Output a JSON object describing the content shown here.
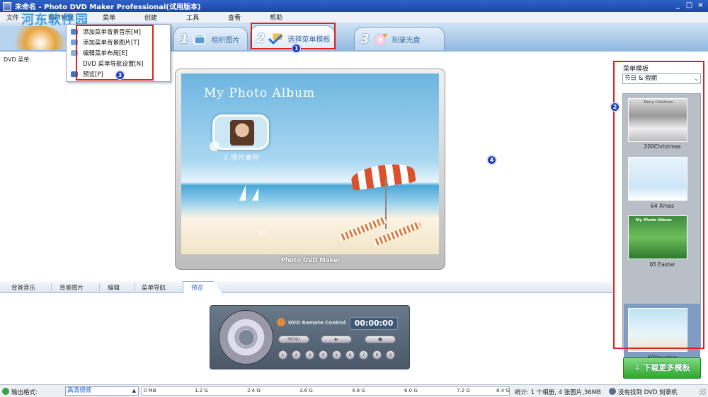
{
  "window": {
    "title": "未命名 - Photo DVD Maker Professional(试用版本)",
    "controls": [
      "_",
      "□",
      "×"
    ]
  },
  "menubar": {
    "items": [
      "文件",
      "照片管理",
      "菜单",
      "创建",
      "工具",
      "查看",
      "帮助"
    ]
  },
  "menu_dropdown": {
    "items": [
      {
        "label": "添加菜单背景音乐[M]"
      },
      {
        "label": "添加菜单背景图片[T]"
      },
      {
        "label": "编辑菜单布局[E]"
      },
      {
        "label": "DVD 菜单导航设置[N]"
      },
      {
        "label": "预览[P]"
      }
    ]
  },
  "steps": [
    {
      "num": "1",
      "label": "组织图片"
    },
    {
      "num": "2",
      "label": "选择菜单模板"
    },
    {
      "num": "3",
      "label": "刻录光盘"
    }
  ],
  "watermark": "河东软件园",
  "dvd_menu_label": "DVD 菜单:",
  "badges": [
    "1",
    "2",
    "3",
    "4"
  ],
  "preview": {
    "album_title": "My Photo Album",
    "photo_caption": "1.图片素材",
    "page_counter": "1/1",
    "frame_caption": "Photo DVD Maker"
  },
  "bottom_tabs": [
    "背景音乐",
    "背景图片",
    "编辑",
    "菜单导航",
    "预览"
  ],
  "remote": {
    "label": "DVD Remote Control",
    "time": "00:00:00",
    "menu_label": "MENU",
    "play_label": "▶",
    "stop_label": "■",
    "numbers": [
      "1",
      "2",
      "3",
      "4",
      "5",
      "6",
      "7",
      "8",
      "9"
    ]
  },
  "template_panel": {
    "title": "菜单模板",
    "category": "节日 & 假期",
    "templates": [
      {
        "name": "200Christmas"
      },
      {
        "name": "64 Xmas"
      },
      {
        "name": "65 Easter"
      },
      {
        "name": "69Vacation"
      }
    ],
    "selected_index": 3,
    "thumb_text": {
      "christmas": "Merry Christmas",
      "easter": "My Photo Album"
    }
  },
  "download_button": "下载更多模板",
  "statusbar": {
    "format_label": "输出格式:",
    "format_value": "高清视频",
    "capacity_ticks": [
      "0 MB",
      "1.2 G",
      "2.4 G",
      "3.6 G",
      "4.8 G",
      "6.0 G",
      "7.2 G",
      "8.4 G"
    ],
    "capacity_used_fraction": 0.0,
    "stats": "统计: 1 个相册, 4 张图片,36MB",
    "burner": "没有找到 DVD 刻录机"
  },
  "colors": {
    "title_blue": "#2f62c8",
    "highlight_red": "#e02020",
    "badge_blue": "#1a3cc8",
    "download_green": "#2fa52f"
  }
}
